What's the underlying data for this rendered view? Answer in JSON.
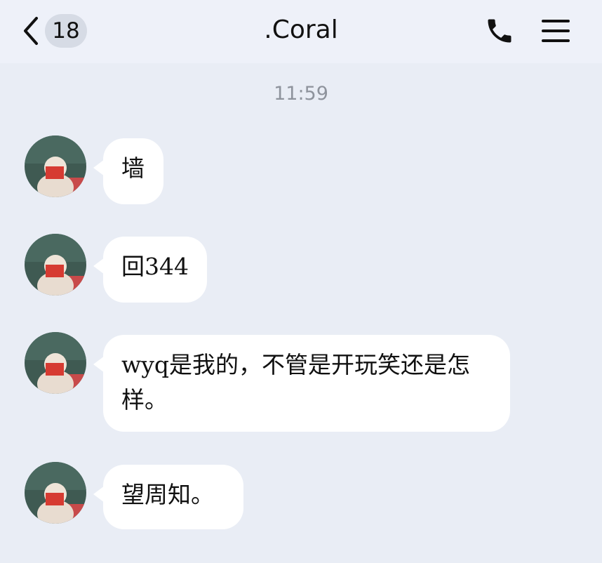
{
  "header": {
    "unread_count": "18",
    "title": ".Coral"
  },
  "icons": {
    "back": "chevron-left-icon",
    "call": "phone-icon",
    "menu": "hamburger-menu-icon"
  },
  "colors": {
    "background": "#e9edf5",
    "header_background": "#eef1f9",
    "bubble": "#ffffff",
    "badge": "#d6dbe5",
    "timestamp": "#8e939c"
  },
  "conversation": {
    "timestamp": "11:59",
    "messages": [
      {
        "sender": "other",
        "text": "墙"
      },
      {
        "sender": "other",
        "text": "回344"
      },
      {
        "sender": "other",
        "text": "wyq是我的，不管是开玩笑还是怎样。"
      },
      {
        "sender": "other",
        "text": "望周知。"
      }
    ]
  }
}
